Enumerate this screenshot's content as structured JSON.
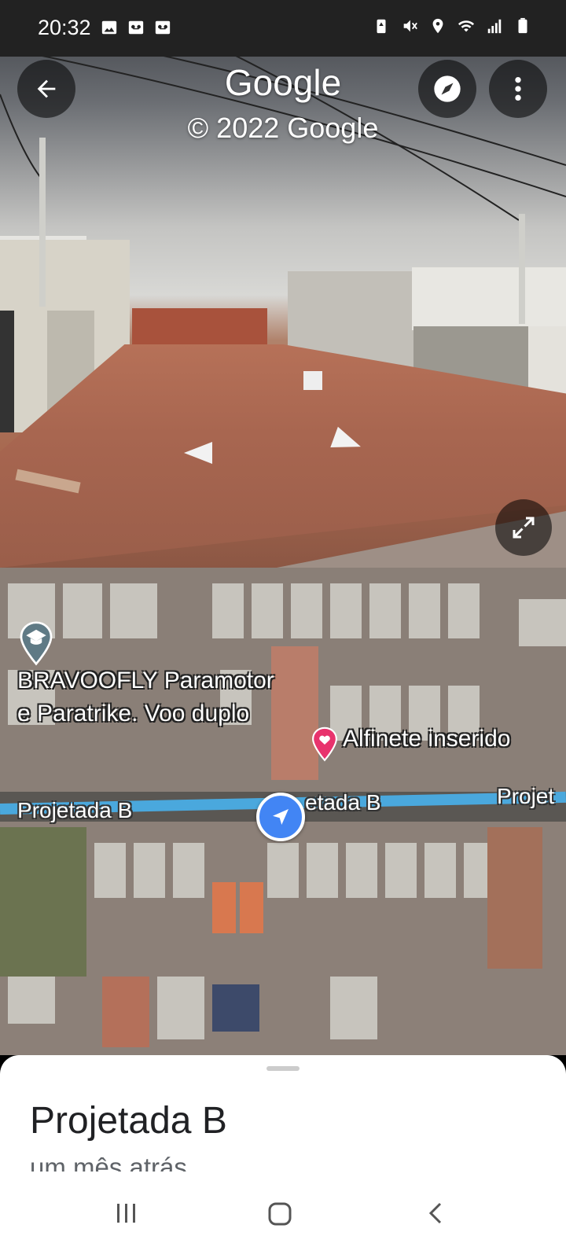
{
  "status_bar": {
    "time": "20:32",
    "left_icons": [
      "image-icon",
      "voicemail-icon",
      "voicemail-icon"
    ],
    "right_icons": [
      "battery-saver-icon",
      "mute-icon",
      "location-icon",
      "wifi-icon",
      "signal-icon",
      "battery-icon"
    ]
  },
  "street_view": {
    "title": "Google",
    "copyright": "© 2022 Google"
  },
  "map": {
    "place_label_line1": "BRAVOOFLY Paramotor",
    "place_label_line2": "e Paratrike. Voo duplo",
    "dropped_pin_label": "Alfinete inserido",
    "road_labels": [
      "Projetada B",
      "etada B",
      "Projet"
    ]
  },
  "sheet": {
    "place_name": "Projetada B",
    "time_ago": "um mês atrás"
  },
  "colors": {
    "road": "#4aa8dd",
    "location_puck": "#4285f4",
    "pin": "#e8336d"
  }
}
